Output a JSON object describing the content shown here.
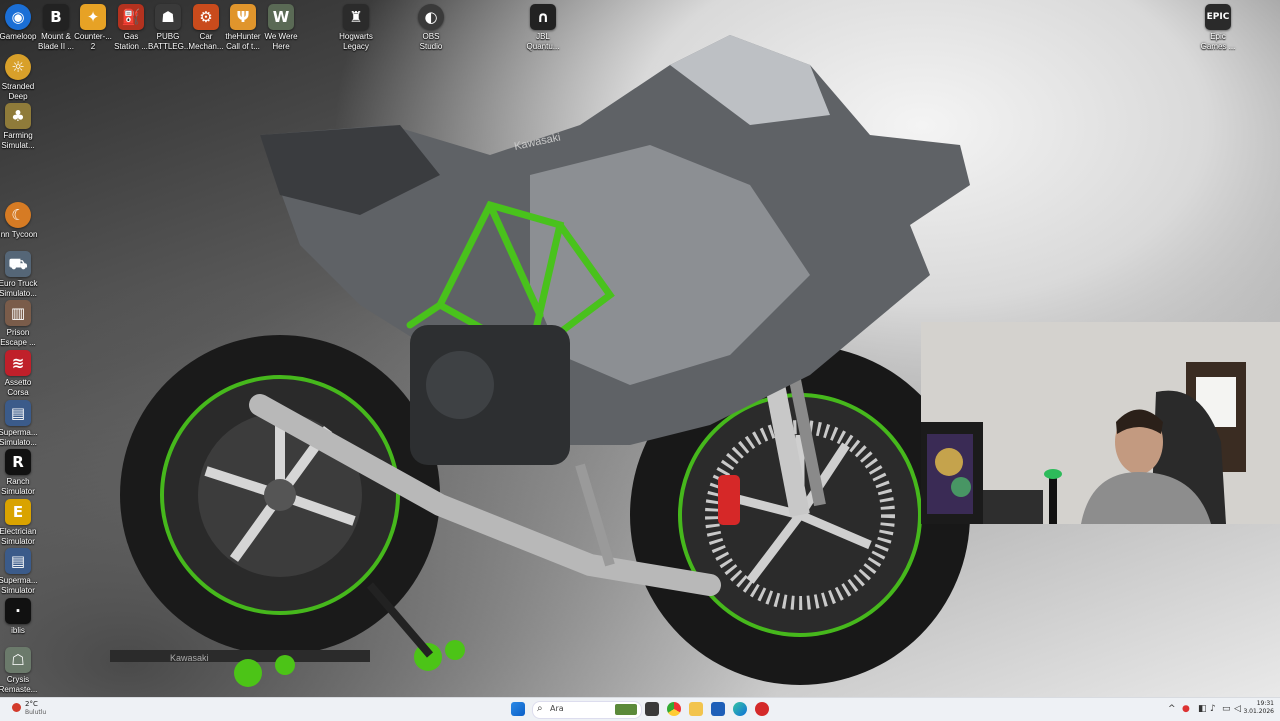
{
  "desktop_icons": [
    {
      "label": "Gameloop",
      "icon": "gameloop-icon",
      "color": "#1b6fd6"
    },
    {
      "label": "Mount & Blade II ...",
      "icon": "bannerlord-icon",
      "color": "#222222"
    },
    {
      "label": "Counter-... 2",
      "icon": "cs2-icon",
      "color": "#e7a225"
    },
    {
      "label": "Gas Station ...",
      "icon": "gas-station-icon",
      "color": "#b3321f"
    },
    {
      "label": "PUBG BATTLEG...",
      "icon": "pubg-icon",
      "color": "#3a3a3a"
    },
    {
      "label": "Car Mechan...",
      "icon": "car-mechanic-icon",
      "color": "#c94b1c"
    },
    {
      "label": "theHunter Call of t...",
      "icon": "thehunter-icon",
      "color": "#e0952c"
    },
    {
      "label": "We Were Here",
      "icon": "we-were-here-icon",
      "color": "#5a6a55"
    },
    {
      "label": "Hogwarts Legacy",
      "icon": "hogwarts-icon",
      "color": "#2b2b2b"
    },
    {
      "label": "OBS Studio",
      "icon": "obs-icon",
      "color": "#3a3a3a"
    },
    {
      "label": "JBL Quantu...",
      "icon": "jbl-quantum-icon",
      "color": "#222222"
    },
    {
      "label": "Epic Games ...",
      "icon": "epic-games-icon",
      "color": "#2a2a2a"
    },
    {
      "label": "Stranded Deep",
      "icon": "stranded-deep-icon",
      "color": "#d8a02a"
    },
    {
      "label": "Farming Simulat...",
      "icon": "farming-sim-icon",
      "color": "#8f7b3a"
    },
    {
      "label": "Inn Tycoon",
      "icon": "inn-tycoon-icon",
      "color": "#d67b24"
    },
    {
      "label": "Euro Truck Simulato...",
      "icon": "euro-truck-icon",
      "color": "#556677"
    },
    {
      "label": "Prison Escape ...",
      "icon": "prison-escape-icon",
      "color": "#7a5c4a"
    },
    {
      "label": "Assetto Corsa",
      "icon": "assetto-corsa-icon",
      "color": "#c0202a"
    },
    {
      "label": "Superma... Simulato...",
      "icon": "supermarket-sim-icon",
      "color": "#3b5b8a"
    },
    {
      "label": "Ranch Simulator",
      "icon": "ranch-sim-icon",
      "color": "#111111"
    },
    {
      "label": "Electrician Simulator",
      "icon": "electrician-sim-icon",
      "color": "#d9a300"
    },
    {
      "label": "Superma... Simulator",
      "icon": "supermarket-sim-2-icon",
      "color": "#3b5b8a"
    },
    {
      "label": "iblis",
      "icon": "iblis-icon",
      "color": "#111111"
    },
    {
      "label": "Crysis Remaste...",
      "icon": "crysis-icon",
      "color": "#6b7a6b"
    }
  ],
  "taskbar": {
    "weather_temp": "2°C",
    "weather_desc": "Bulutlu",
    "search_placeholder": "Ara",
    "apps": [
      "windows-start-icon",
      "search-icon",
      "minecraft-icon",
      "taskview-icon",
      "chrome-icon",
      "file-explorer-icon",
      "store-icon",
      "edge-icon",
      "recording-icon"
    ],
    "clock_time": "19:31",
    "clock_date": "3.01.2026"
  },
  "wallpaper": {
    "subject": "Kawasaki",
    "brand_text": "Kawasaki",
    "accent": "#49c21c"
  },
  "colors": {
    "taskbar_bg": "#eef1f5",
    "frame_green": "#4cc417"
  }
}
